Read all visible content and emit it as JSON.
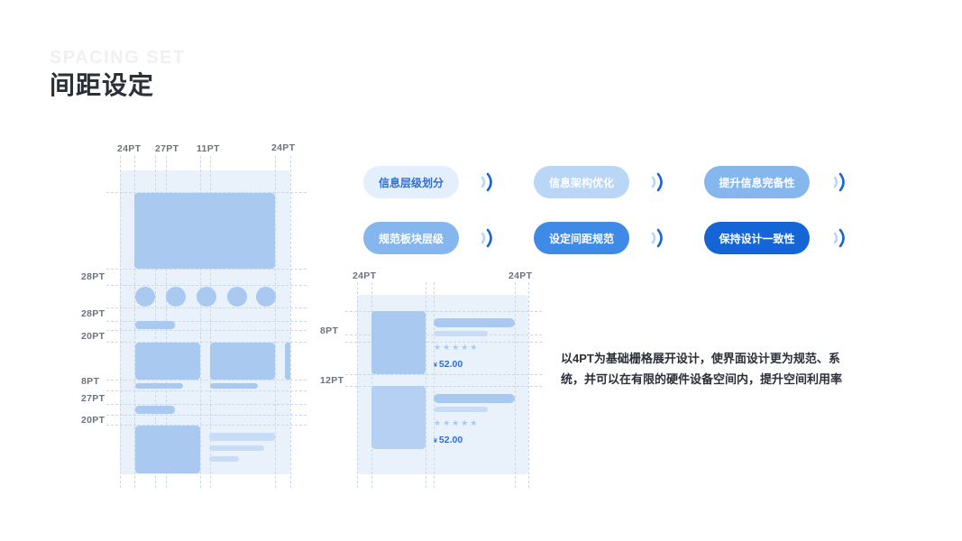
{
  "header": {
    "ghost_title": "SPACING SET",
    "title": "间距设定"
  },
  "left_mock": {
    "top_labels": [
      "24PT",
      "27PT",
      "11PT",
      "24PT"
    ],
    "side_labels": [
      "28PT",
      "28PT",
      "20PT",
      "8PT",
      "27PT",
      "20PT"
    ]
  },
  "pills": [
    {
      "label": "信息层级划分",
      "bg": "#e3effd",
      "fg": "#2f6fd0"
    },
    {
      "label": "信息架构优化",
      "bg": "#b9d6f7",
      "fg": "#ffffff"
    },
    {
      "label": "提升信息完备性",
      "bg": "#86b6ee",
      "fg": "#ffffff"
    },
    {
      "label": "规范板块层级",
      "bg": "#86b6ee",
      "fg": "#ffffff"
    },
    {
      "label": "设定间距规范",
      "bg": "#3f8ae6",
      "fg": "#ffffff"
    },
    {
      "label": "保持设计一致性",
      "bg": "#1565d6",
      "fg": "#ffffff"
    }
  ],
  "right_mock": {
    "top_labels": [
      "24PT",
      "24PT"
    ],
    "side_labels": [
      "8PT",
      "12PT"
    ],
    "items": [
      {
        "stars": "★★★★★",
        "currency": "¥",
        "price": "52.00"
      },
      {
        "stars": "★★★★★",
        "currency": "¥",
        "price": "52.00"
      }
    ]
  },
  "description": "以4PT为基础栅格展开设计，使界面设计更为规范、系统，并可以在有限的硬件设备空间内，提升空间利用率",
  "colors": {
    "accent": "#1565d6",
    "block": "#a9c9f1",
    "panel": "#e9f1fb"
  }
}
